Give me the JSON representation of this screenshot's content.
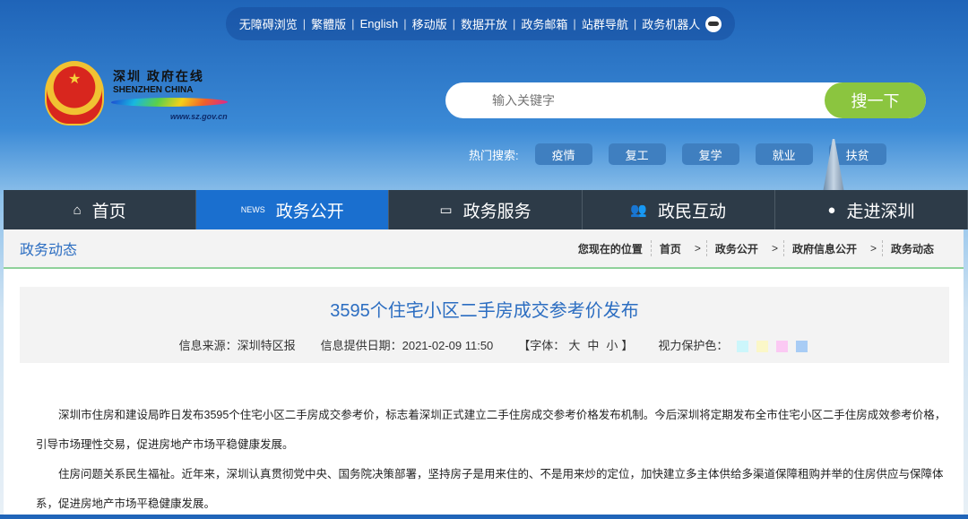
{
  "top_links": [
    "无障碍浏览",
    "繁體版",
    "English",
    "移动版",
    "数据开放",
    "政务邮箱",
    "站群导航",
    "政务机器人"
  ],
  "logo": {
    "cn": "深圳 政府在线",
    "en": "SHENZHEN CHINA",
    "url": "www.sz.gov.cn"
  },
  "search": {
    "placeholder": "输入关键字",
    "button": "搜一下"
  },
  "hot": {
    "label": "热门搜索:",
    "tags": [
      "疫情",
      "复工",
      "复学",
      "就业",
      "扶贫"
    ]
  },
  "nav": [
    {
      "label": "首页",
      "icon": "home-icon"
    },
    {
      "label": "政务公开",
      "icon": "news-icon",
      "active": true
    },
    {
      "label": "政务服务",
      "icon": "monitor-icon"
    },
    {
      "label": "政民互动",
      "icon": "people-icon"
    },
    {
      "label": "走进深圳",
      "icon": "chat-icon"
    }
  ],
  "section_title": "政务动态",
  "breadcrumb": {
    "label": "您现在的位置",
    "items": [
      "首页",
      "政务公开",
      "政府信息公开",
      "政务动态"
    ]
  },
  "article": {
    "title": "3595个住宅小区二手房成交参考价发布",
    "source": "信息来源：深圳特区报",
    "date": "信息提供日期：2021-02-09 11:50",
    "font_label": "【字体：",
    "font_sizes": [
      "大",
      "中",
      "小"
    ],
    "font_close": "】",
    "eye_label": "视力保护色：",
    "eye_colors": [
      "#ccf6fb",
      "#fbf7c8",
      "#fbc9f3",
      "#a8ccf5"
    ],
    "paragraphs": [
      "深圳市住房和建设局昨日发布3595个住宅小区二手房成交参考价，标志着深圳正式建立二手住房成交参考价格发布机制。今后深圳将定期发布全市住宅小区二手住房成效参考价格，引导市场理性交易，促进房地产市场平稳健康发展。",
      "住房问题关系民生福祉。近年来，深圳认真贯彻党中央、国务院决策部署，坚持房子是用来住的、不是用来炒的定位，加快建立多主体供给多渠道保障租购并举的住房供应与保障体系，促进房地产市场平稳健康发展。"
    ]
  }
}
